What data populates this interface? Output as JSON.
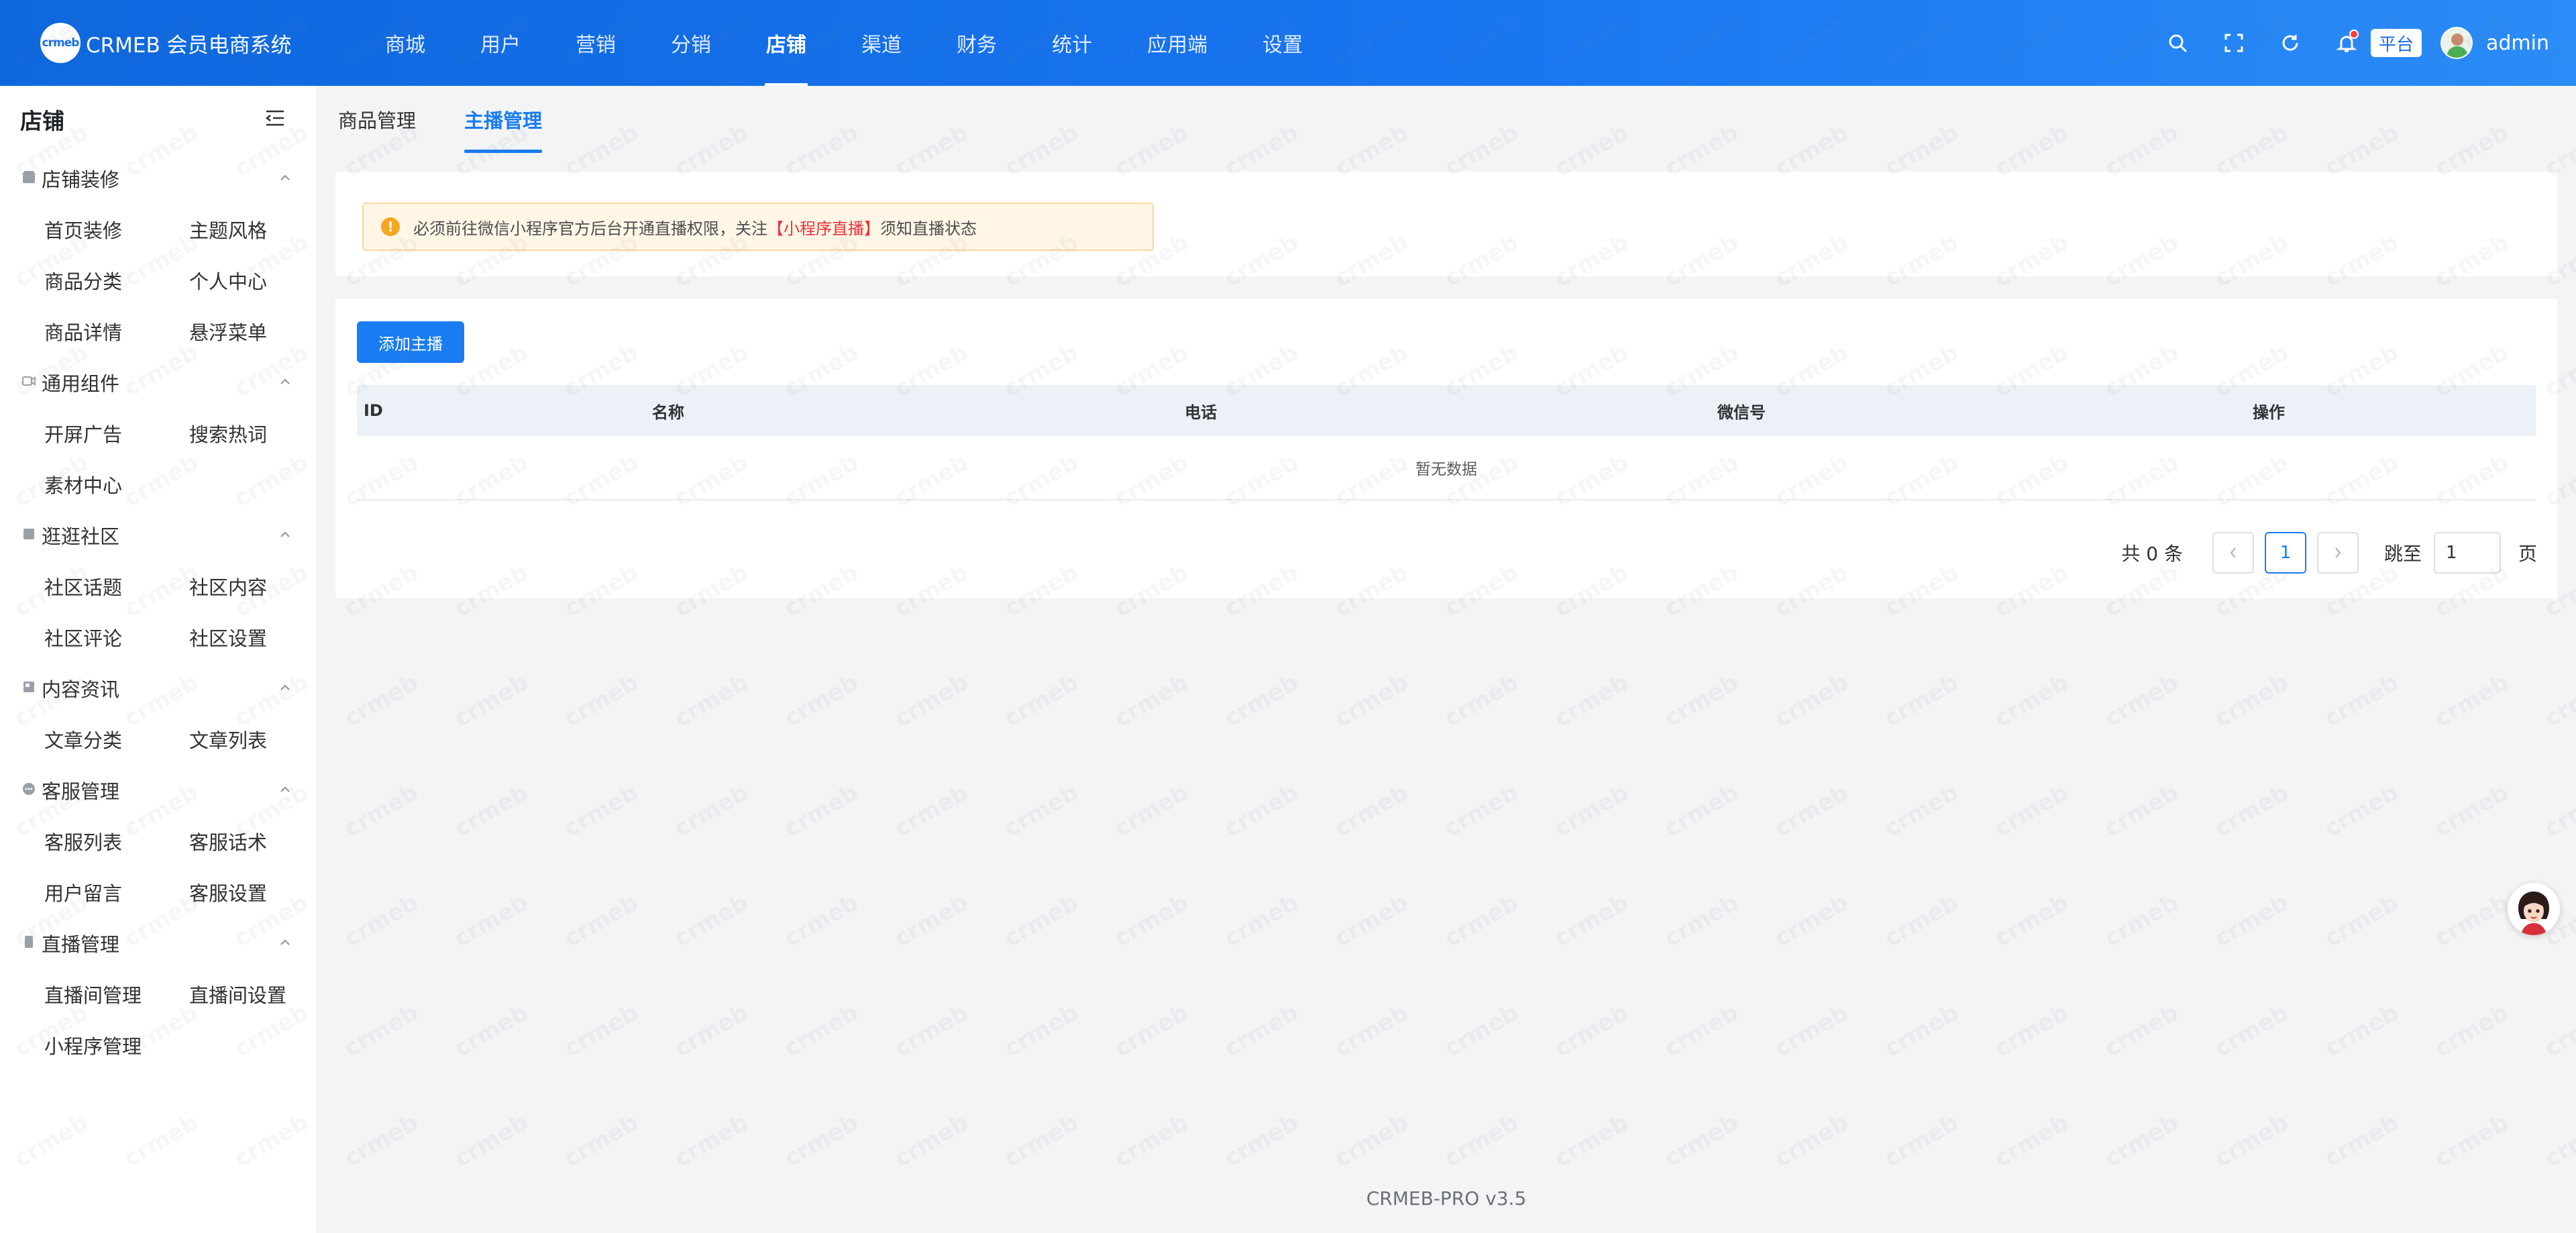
{
  "app": {
    "logo_mark": "crmeb",
    "logo_text": "CRMEB 会员电商系统"
  },
  "top_nav": [
    "商城",
    "用户",
    "营销",
    "分销",
    "店铺",
    "渠道",
    "财务",
    "统计",
    "应用端",
    "设置"
  ],
  "top_nav_active": "店铺",
  "header_right": {
    "platform_badge": "平台",
    "username": "admin"
  },
  "sidebar": {
    "title": "店铺",
    "groups": [
      {
        "label": "店铺装修",
        "icon": "store-icon",
        "items": [
          "首页装修",
          "主题风格",
          "商品分类",
          "个人中心",
          "商品详情",
          "悬浮菜单"
        ]
      },
      {
        "label": "通用组件",
        "icon": "component-icon",
        "items": [
          "开屏广告",
          "搜索热词",
          "素材中心"
        ]
      },
      {
        "label": "逛逛社区",
        "icon": "community-icon",
        "items": [
          "社区话题",
          "社区内容",
          "社区评论",
          "社区设置"
        ]
      },
      {
        "label": "内容资讯",
        "icon": "article-icon",
        "items": [
          "文章分类",
          "文章列表"
        ]
      },
      {
        "label": "客服管理",
        "icon": "chat-icon",
        "items": [
          "客服列表",
          "客服话术",
          "用户留言",
          "客服设置"
        ]
      },
      {
        "label": "直播管理",
        "icon": "live-icon",
        "items": [
          "直播间管理",
          "直播间设置",
          "小程序管理"
        ]
      }
    ]
  },
  "tabs": [
    "商品管理",
    "主播管理"
  ],
  "active_tab": "主播管理",
  "notice": {
    "prefix": "必须前往微信小程序官方后台开通直播权限，关注",
    "highlight": "【小程序直播】",
    "suffix": "须知直播状态"
  },
  "add_button_label": "添加主播",
  "table": {
    "columns": [
      "ID",
      "名称",
      "电话",
      "微信号",
      "操作"
    ],
    "empty_text": "暂无数据"
  },
  "pagination": {
    "total_text": "共 0 条",
    "current_page": "1",
    "jump_label": "跳至",
    "jump_value": "1",
    "page_unit": "页"
  },
  "footer": "CRMEB-PRO v3.5",
  "watermark_text": "crmeb",
  "colors": {
    "primary": "#1a7cf2",
    "topbar_start": "#0e67dd",
    "topbar_end": "#2a8cf6",
    "warning": "#f5a623",
    "danger": "#e8333c"
  }
}
